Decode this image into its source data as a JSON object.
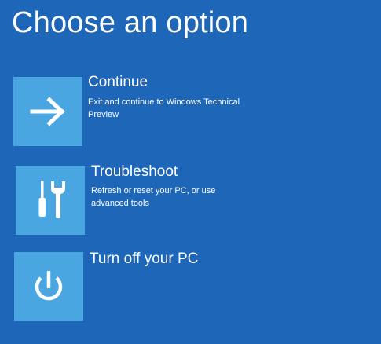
{
  "page": {
    "title": "Choose an option"
  },
  "colors": {
    "background": "#1e66b8",
    "tile": "#4aa6e0",
    "text": "#ffffff"
  },
  "options": [
    {
      "title": "Continue",
      "description": "Exit and continue to Windows Technical Preview",
      "icon": "arrow-right-icon"
    },
    {
      "title": "Troubleshoot",
      "description": "Refresh or reset your PC, or use advanced tools",
      "icon": "tools-icon"
    },
    {
      "title": "Turn off your PC",
      "description": "",
      "icon": "power-icon"
    }
  ]
}
